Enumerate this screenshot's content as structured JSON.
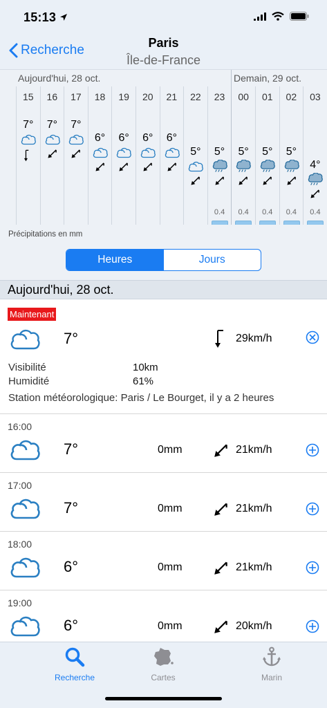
{
  "status": {
    "time": "15:13"
  },
  "nav": {
    "back_label": "Recherche",
    "title": "Paris",
    "subtitle": "Île-de-France"
  },
  "strip": {
    "day_today": "Aujourd'hui, 28 oct.",
    "day_tomorrow": "Demain, 29 oct.",
    "hours": [
      {
        "h": "15",
        "t": "7°",
        "icon": "cloud-icon",
        "wind": "wind-arrow-down-icon",
        "precip": ""
      },
      {
        "h": "16",
        "t": "7°",
        "icon": "cloud-icon",
        "wind": "wind-arrow-sw-icon",
        "precip": ""
      },
      {
        "h": "17",
        "t": "7°",
        "icon": "cloud-icon",
        "wind": "wind-arrow-sw-icon",
        "precip": ""
      },
      {
        "h": "18",
        "t": "6°",
        "icon": "cloud-icon",
        "wind": "wind-arrow-sw-icon",
        "precip": ""
      },
      {
        "h": "19",
        "t": "6°",
        "icon": "cloud-icon",
        "wind": "wind-arrow-sw-icon",
        "precip": ""
      },
      {
        "h": "20",
        "t": "6°",
        "icon": "cloud-icon",
        "wind": "wind-arrow-sw-icon",
        "precip": ""
      },
      {
        "h": "21",
        "t": "6°",
        "icon": "cloud-icon",
        "wind": "wind-arrow-sw-icon",
        "precip": ""
      },
      {
        "h": "22",
        "t": "5°",
        "icon": "cloud-icon",
        "wind": "wind-arrow-sw-icon",
        "precip": ""
      },
      {
        "h": "23",
        "t": "5°",
        "icon": "rain-cloud-icon",
        "wind": "wind-arrow-sw-icon",
        "precip": "0.4"
      },
      {
        "h": "00",
        "t": "5°",
        "icon": "rain-cloud-icon",
        "wind": "wind-arrow-sw-icon",
        "precip": "0.4"
      },
      {
        "h": "01",
        "t": "5°",
        "icon": "rain-cloud-icon",
        "wind": "wind-arrow-sw-icon",
        "precip": "0.4"
      },
      {
        "h": "02",
        "t": "5°",
        "icon": "rain-cloud-icon",
        "wind": "wind-arrow-sw-icon",
        "precip": "0.4"
      },
      {
        "h": "03",
        "t": "4°",
        "icon": "rain-cloud-icon",
        "wind": "wind-arrow-sw-icon",
        "precip": "0.4"
      }
    ],
    "caption": "Précipitations en mm"
  },
  "segmented": {
    "hours": "Heures",
    "days": "Jours"
  },
  "day_header": "Aujourd'hui, 28 oct.",
  "now": {
    "badge": "Maintenant",
    "temp": "7°",
    "wind": "29km/h",
    "visibility_label": "Visibilité",
    "visibility_value": "10km",
    "humidity_label": "Humidité",
    "humidity_value": "61%",
    "station": "Station météorologique: Paris / Le Bourget, il y a 2 heures"
  },
  "rows": [
    {
      "time": "16:00",
      "temp": "7°",
      "precip": "0mm",
      "wind": "21km/h"
    },
    {
      "time": "17:00",
      "temp": "7°",
      "precip": "0mm",
      "wind": "21km/h"
    },
    {
      "time": "18:00",
      "temp": "6°",
      "precip": "0mm",
      "wind": "21km/h"
    },
    {
      "time": "19:00",
      "temp": "6°",
      "precip": "0mm",
      "wind": "20km/h"
    }
  ],
  "tabs": [
    {
      "label": "Recherche",
      "icon": "search-icon",
      "active": true
    },
    {
      "label": "Cartes",
      "icon": "france-map-icon",
      "active": false
    },
    {
      "label": "Marin",
      "icon": "anchor-icon",
      "active": false
    }
  ],
  "colors": {
    "accent": "#1a7cf2",
    "badge": "#e8191c",
    "bar_bg": "#eaf0f7"
  }
}
